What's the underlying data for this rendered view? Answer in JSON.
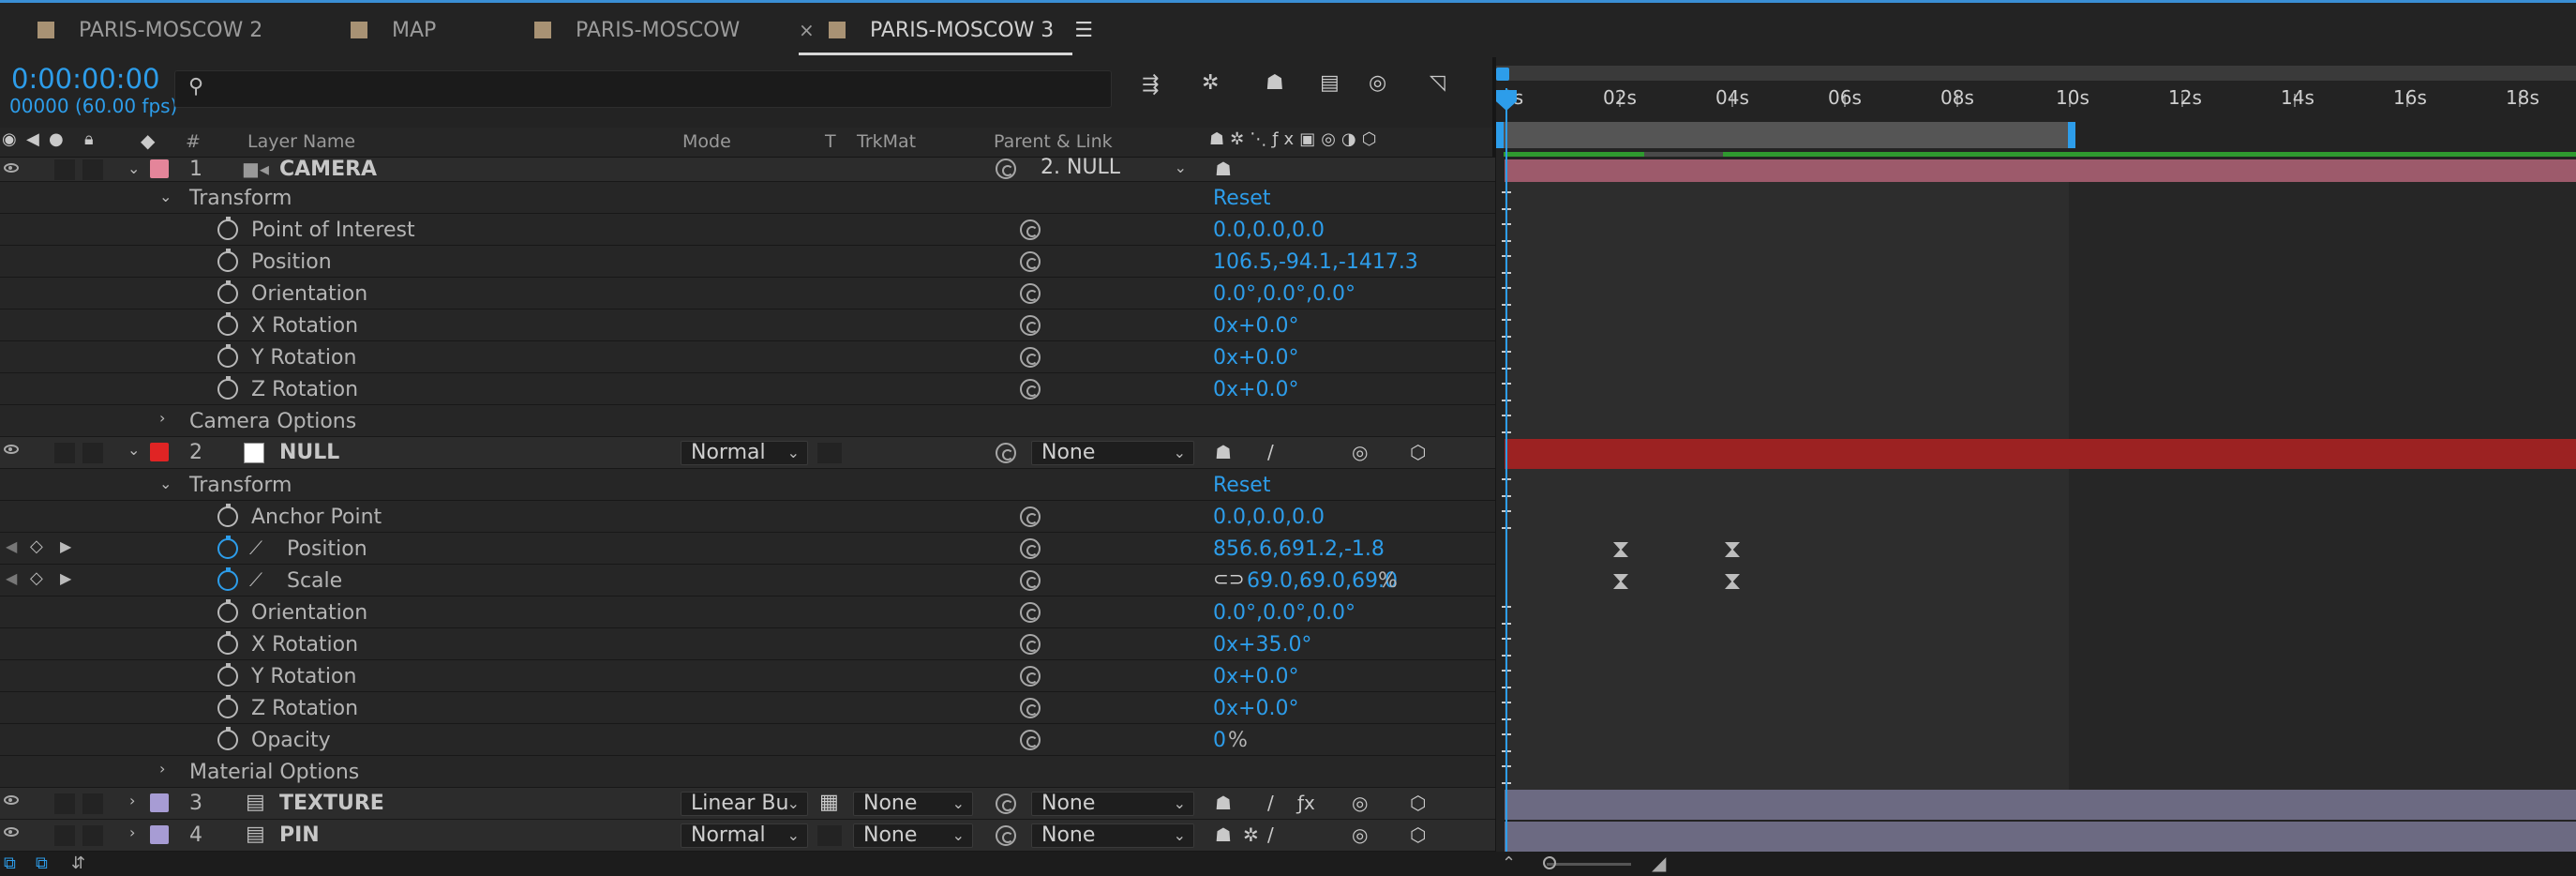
{
  "tabs": [
    {
      "label": "PARIS-MOSCOW 2",
      "active": false
    },
    {
      "label": "MAP",
      "active": false
    },
    {
      "label": "PARIS-MOSCOW",
      "active": false
    },
    {
      "label": "PARIS-MOSCOW 3",
      "active": true
    }
  ],
  "header": {
    "timecode": "0:00:00:00",
    "frames": "00000 (60.00 fps)",
    "search_placeholder": ""
  },
  "columns": {
    "number": "#",
    "layer_name": "Layer Name",
    "mode": "Mode",
    "t": "T",
    "trkmat": "TrkMat",
    "parent": "Parent & Link"
  },
  "layers": {
    "camera": {
      "num": "1",
      "name": "CAMERA",
      "parent": "2. NULL",
      "color": "#e4859a"
    },
    "null": {
      "num": "2",
      "name": "NULL",
      "mode": "Normal",
      "parent": "None",
      "color": "#e02424"
    },
    "texture": {
      "num": "3",
      "name": "TEXTURE",
      "mode": "Linear Bu",
      "trkmat": "None",
      "parent": "None",
      "color": "#a79cd4"
    },
    "pin": {
      "num": "4",
      "name": "PIN",
      "mode": "Normal",
      "trkmat": "None",
      "parent": "None",
      "color": "#a79cd4"
    }
  },
  "camera_props": {
    "transform": "Transform",
    "reset": "Reset",
    "point_of_interest": {
      "label": "Point of Interest",
      "value": "0.0,0.0,0.0"
    },
    "position": {
      "label": "Position",
      "value": "106.5,-94.1,-1417.3"
    },
    "orientation": {
      "label": "Orientation",
      "value": "0.0°,0.0°,0.0°"
    },
    "x_rotation": {
      "label": "X Rotation",
      "value": "0x+0.0°"
    },
    "y_rotation": {
      "label": "Y Rotation",
      "value": "0x+0.0°"
    },
    "z_rotation": {
      "label": "Z Rotation",
      "value": "0x+0.0°"
    },
    "camera_options": "Camera Options"
  },
  "null_props": {
    "transform": "Transform",
    "reset": "Reset",
    "anchor_point": {
      "label": "Anchor Point",
      "value": "0.0,0.0,0.0"
    },
    "position": {
      "label": "Position",
      "value": "856.6,691.2,-1.8"
    },
    "scale": {
      "label": "Scale",
      "value": "69.0,69.0,69.0",
      "unit": "%"
    },
    "orientation": {
      "label": "Orientation",
      "value": "0.0°,0.0°,0.0°"
    },
    "x_rotation": {
      "label": "X Rotation",
      "value": "0x+35.0°"
    },
    "y_rotation": {
      "label": "Y Rotation",
      "value": "0x+0.0°"
    },
    "z_rotation": {
      "label": "Z Rotation",
      "value": "0x+0.0°"
    },
    "opacity": {
      "label": "Opacity",
      "value": "0",
      "unit": "%"
    },
    "material_options": "Material Options"
  },
  "timeline": {
    "ticks": [
      "0s",
      "02s",
      "04s",
      "06s",
      "08s",
      "10s",
      "12s",
      "14s",
      "16s",
      "18s"
    ],
    "work_area_end": "10s"
  },
  "colors": {
    "accent": "#2d9dea",
    "camera_bar": "#9d5a6b",
    "null_bar": "#9c2222",
    "texture_bar": "#6c6a82",
    "work_area": "#3e8fd4",
    "green_bar": "#2f9a2f"
  }
}
